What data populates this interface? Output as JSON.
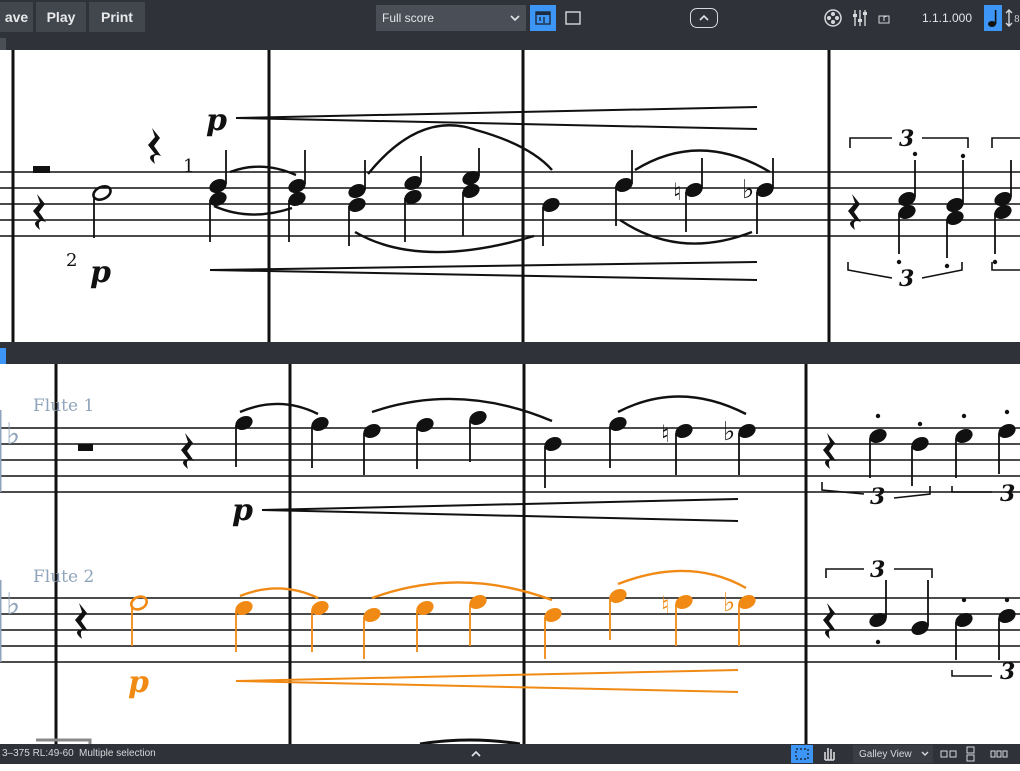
{
  "toolbar": {
    "save_label": "ave",
    "play_label": "Play",
    "print_label": "Print",
    "layout_select": "Full score",
    "position": "1.1.1.000",
    "accent": "#3d96f5"
  },
  "score": {
    "top_pane": {
      "fingering_1": "1",
      "fingering_2": "2",
      "dynamic_top": "p",
      "dynamic_bottom": "p",
      "tuplet_top": "3",
      "tuplet_bottom": "3"
    },
    "flute1": {
      "name": "Flute 1",
      "dynamic": "p",
      "tuplet_a": "3",
      "tuplet_b": "3"
    },
    "flute2": {
      "name": "Flute 2",
      "dynamic": "p",
      "tuplet_a": "3",
      "tuplet_b": "3",
      "selection_color": "#f08a14"
    }
  },
  "status": {
    "range_text": "3–375 RL:49-60",
    "selection_text": "Multiple selection",
    "view_select": "Galley View"
  }
}
